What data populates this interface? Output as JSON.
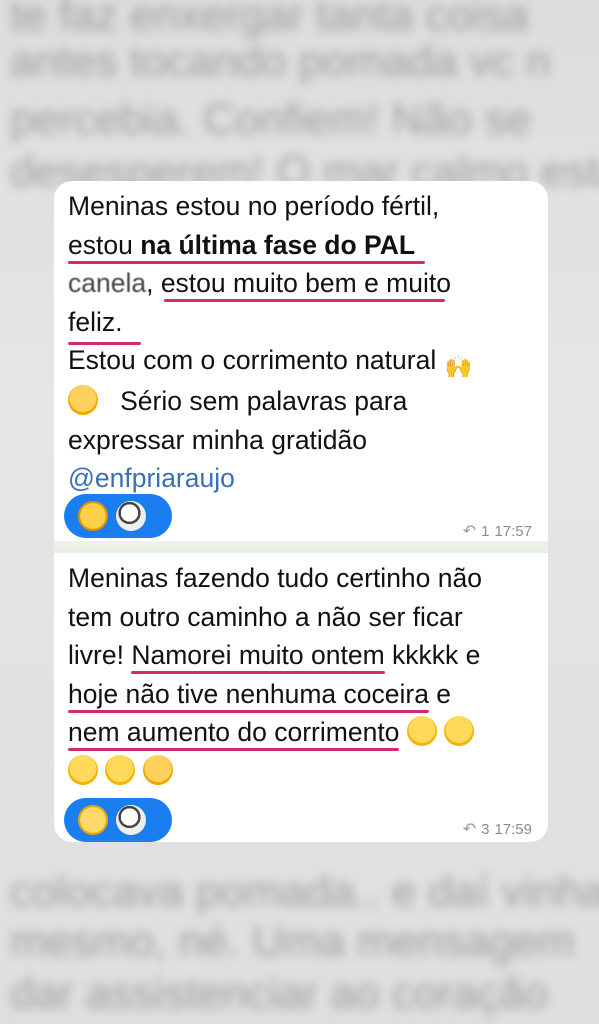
{
  "background_lines": [
    "te faz enxergar tanta coisa",
    "antes tocando pomada vc n",
    "percebia. Confiem! Não se",
    "desesperem! O mar calmo está",
    "colocava pomada.. e daí vinha",
    "mesmo, né. Uma mensagem",
    "dar assistenciar ao coração"
  ],
  "messages": [
    {
      "line1": "Meninas estou no período fértil,",
      "line2_a": "estou ",
      "line2_bold": "na última fase do PAL",
      "line3_cut": "canela",
      "line3_rest": ", estou muito bem e muito",
      "line4": "feliz.",
      "line5": "Estou com o corrimento natural",
      "line6": "Sério sem palavras para",
      "line7": "expressar minha gratidão",
      "mention": "@enfpriaraujo",
      "reply_count": "1",
      "time": "17:57"
    },
    {
      "line1": "Meninas fazendo tudo certinho não",
      "line2": "tem outro caminho a não ser ficar",
      "line3_a": "livre! ",
      "line3_u": "Namorei muito ontem",
      "line3_b": " kkkkk e",
      "line4_u": "hoje não tive nenhuma coceira",
      "line4_b": " e",
      "line5_u": "nem aumento do corrimento",
      "reply_count": "3",
      "time": "17:59"
    }
  ],
  "colors": {
    "underline": "#d32a6f",
    "mention": "#3b6fb6",
    "reaction_bg": "#1a7df0"
  },
  "icons": [
    "raised-hands-icon",
    "smiling-face-icon",
    "starstruck-face-icon",
    "face-with-hearts-icon",
    "soccer-ball-icon",
    "clapping-hands-icon",
    "reply-arrow-icon"
  ]
}
